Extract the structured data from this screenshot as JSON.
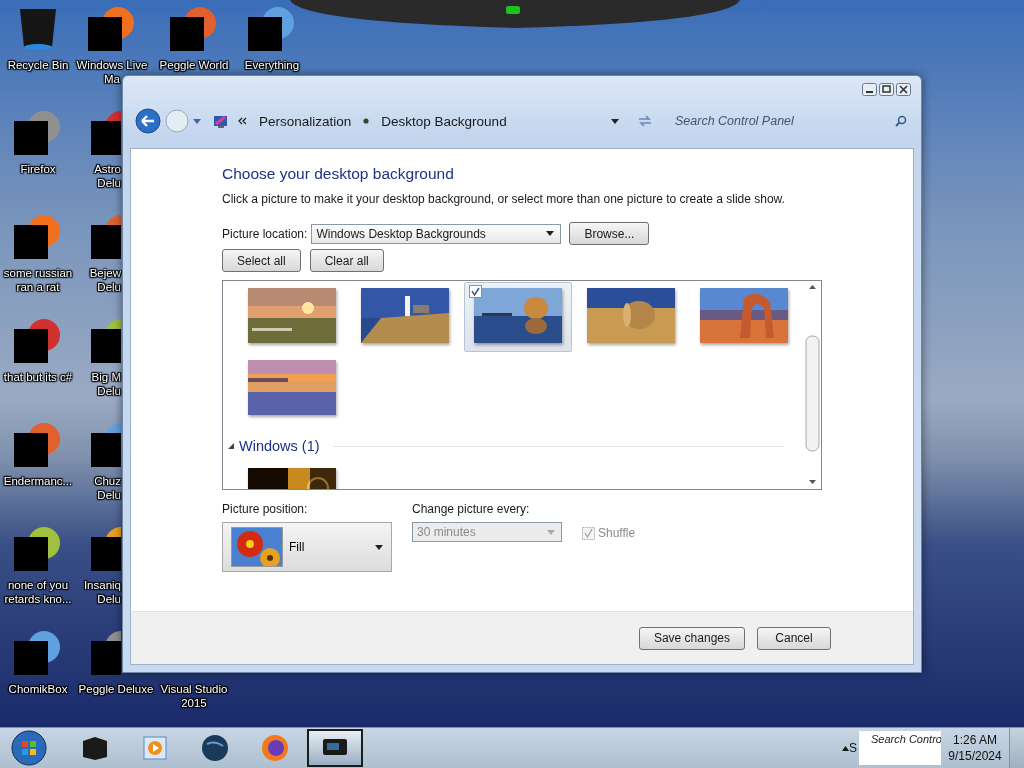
{
  "desktop": {
    "rows": [
      {
        "icons": [
          {
            "kind": "bin",
            "lines": [
              "Recycle Bin"
            ]
          },
          {
            "kind": "app",
            "lines": [
              "Windows Live",
              "Ma"
            ]
          },
          {
            "kind": "app",
            "lines": [
              "Peggle World"
            ]
          },
          {
            "kind": "app",
            "lines": [
              "Everything"
            ]
          }
        ]
      },
      {
        "icons": [
          {
            "kind": "app",
            "lines": [
              "Firefox"
            ]
          },
          {
            "kind": "app",
            "lines": [
              "Astro",
              "Delu"
            ]
          }
        ]
      },
      {
        "icons": [
          {
            "kind": "app",
            "lines": [
              "some russian",
              "ran a rat"
            ]
          },
          {
            "kind": "app",
            "lines": [
              "Bejew",
              "Delu"
            ]
          }
        ]
      },
      {
        "icons": [
          {
            "kind": "app",
            "lines": [
              "that but its c#"
            ]
          },
          {
            "kind": "app",
            "lines": [
              "Big M",
              "Delu"
            ]
          }
        ]
      },
      {
        "icons": [
          {
            "kind": "app",
            "lines": [
              "Endermanc..."
            ]
          },
          {
            "kind": "app",
            "lines": [
              "Chuz",
              "Delu"
            ]
          }
        ]
      },
      {
        "icons": [
          {
            "kind": "app",
            "lines": [
              "none of you",
              "retards kno..."
            ]
          },
          {
            "kind": "app",
            "lines": [
              "Insaniq",
              "Delu"
            ]
          }
        ]
      },
      {
        "icons": [
          {
            "kind": "app",
            "lines": [
              "ChomikBox"
            ]
          },
          {
            "kind": "app",
            "lines": [
              "Peggle Deluxe"
            ]
          },
          {
            "lines": [
              "Visual Studio",
              "2015"
            ]
          }
        ]
      }
    ]
  },
  "window": {
    "breadcrumb": [
      "Personalization",
      "Desktop Background"
    ],
    "search": {
      "placeholder": "Search Control Panel"
    },
    "heading": "Choose your desktop background",
    "description": "Click a picture to make it your desktop background, or select more than one picture to create a slide show.",
    "location": {
      "label": "Picture location:",
      "value": "Windows Desktop Backgrounds"
    },
    "browse_button": "Browse...",
    "select_all_button": "Select all",
    "clear_all_button": "Clear all",
    "groups": [
      {
        "thumbnails": [
          {
            "selected": false,
            "checked": false
          },
          {
            "selected": false,
            "checked": false
          },
          {
            "selected": true,
            "checked": true
          },
          {
            "selected": false,
            "checked": false
          },
          {
            "selected": false,
            "checked": false
          },
          {
            "selected": false,
            "checked": false
          }
        ]
      },
      {
        "title": "Windows (1)",
        "expanded": true,
        "thumbnails": [
          {
            "selected": false,
            "checked": false
          }
        ]
      }
    ],
    "position": {
      "label": "Picture position:",
      "value": "Fill"
    },
    "interval": {
      "label": "Change picture every:",
      "value": "30 minutes",
      "disabled": true
    },
    "shuffle": {
      "label": "Shuffle",
      "checked": true,
      "disabled": true
    },
    "footer_buttons": [
      "Save changes",
      "Cancel"
    ]
  },
  "taskbar": {
    "items": [
      {
        "selected": false
      },
      {
        "selected": false
      },
      {
        "selected": false
      },
      {
        "selected": false
      },
      {
        "selected": true
      }
    ],
    "tray_letter": "S",
    "tray_popup": "Search Contro",
    "time": "1:26 AM",
    "date": "9/15/2024"
  }
}
